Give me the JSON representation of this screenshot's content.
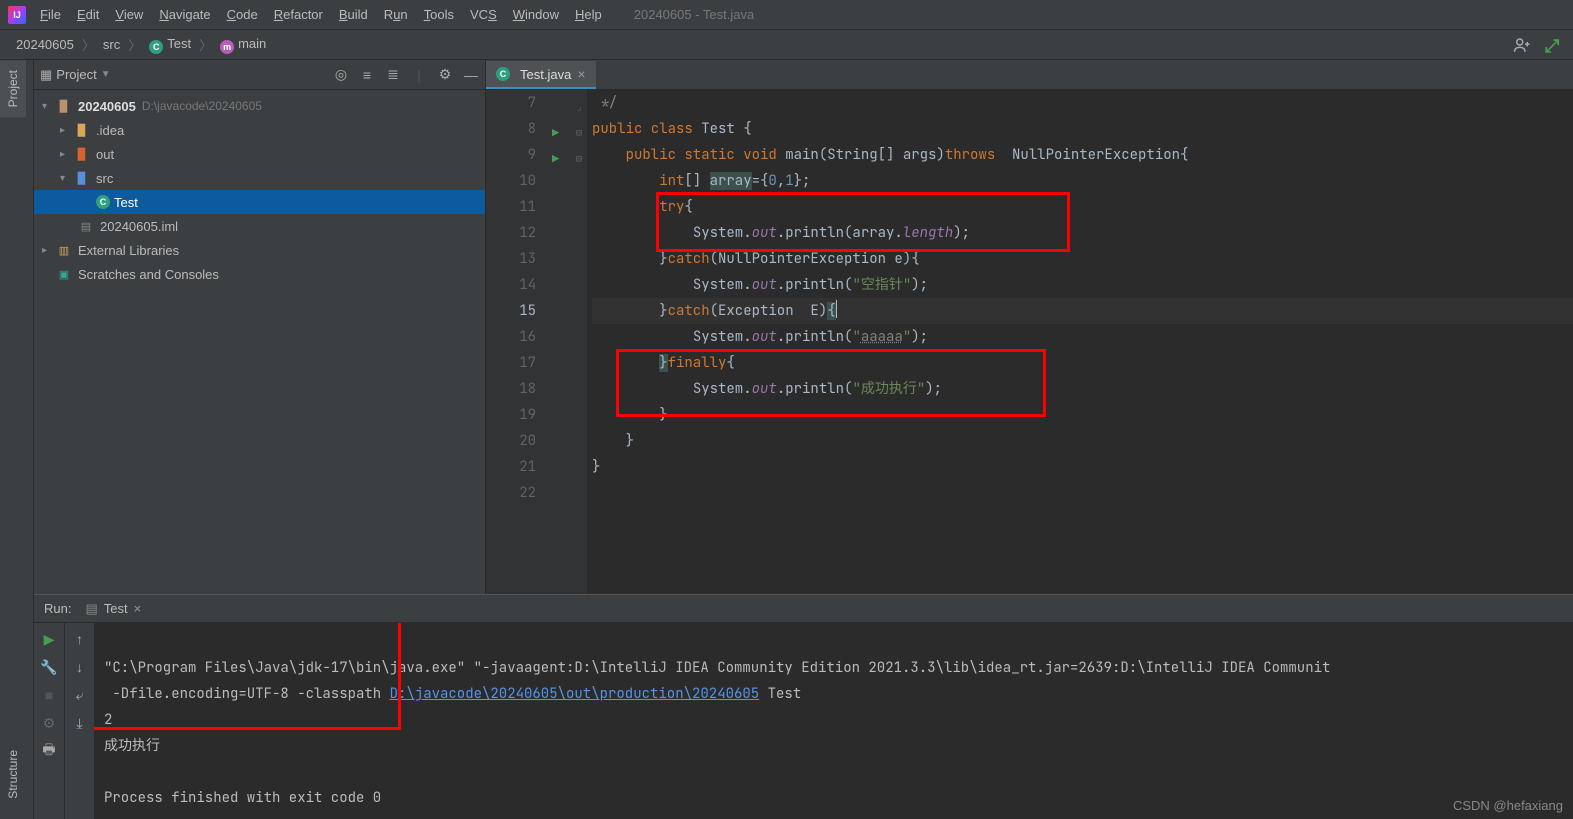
{
  "window_title": "20240605 - Test.java",
  "menu": [
    "File",
    "Edit",
    "View",
    "Navigate",
    "Code",
    "Refactor",
    "Build",
    "Run",
    "Tools",
    "VCS",
    "Window",
    "Help"
  ],
  "breadcrumbs": {
    "root": "20240605",
    "src": "src",
    "cls": "Test",
    "method": "main"
  },
  "sidebar": {
    "project": "Project",
    "structure": "Structure"
  },
  "project_panel": {
    "title": "Project",
    "tree": {
      "root": {
        "name": "20240605",
        "path": "D:\\javacode\\20240605"
      },
      "idea": ".idea",
      "out": "out",
      "src": "src",
      "test": "Test",
      "iml": "20240605.iml",
      "ext": "External Libraries",
      "scratch": "Scratches and Consoles"
    }
  },
  "editor": {
    "tab": "Test.java",
    "lines": {
      "l7": " */",
      "l8": "public class Test {",
      "l9": "    public static void main(String[] args)throws  NullPointerException{",
      "l10": "        int[] array={0,1};",
      "l11": "        try{",
      "l12": "            System.out.println(array.length);",
      "l13": "        }catch(NullPointerException e){",
      "l14": "            System.out.println(\"空指针\");",
      "l15": "        }catch(Exception  E){",
      "l16": "            System.out.println(\"aaaaa\");",
      "l17": "        }finally{",
      "l18": "            System.out.println(\"成功执行\");",
      "l19": "        }",
      "l20": "    }",
      "l21": "}",
      "l22": ""
    },
    "gutter_start": 7,
    "gutter_end": 22,
    "current_line": 15
  },
  "run": {
    "panel_label": "Run:",
    "tab": "Test",
    "cmd_prefix": "\"C:\\Program Files\\Java\\jdk-17\\bin\\java.exe\" \"-javaagent:D:\\IntelliJ IDEA Community Edition 2021.3.3\\lib\\idea_rt.jar=2639:D:\\IntelliJ IDEA Communit",
    "cmd_line2_a": " -Dfile.encoding=UTF-8 -classpath ",
    "cmd_link": "D:\\javacode\\20240605\\out\\production\\20240605",
    "cmd_line2_b": " Test",
    "out1": "2",
    "out2": "成功执行",
    "exit": "Process finished with exit code 0"
  },
  "watermark": "CSDN @hefaxiang"
}
